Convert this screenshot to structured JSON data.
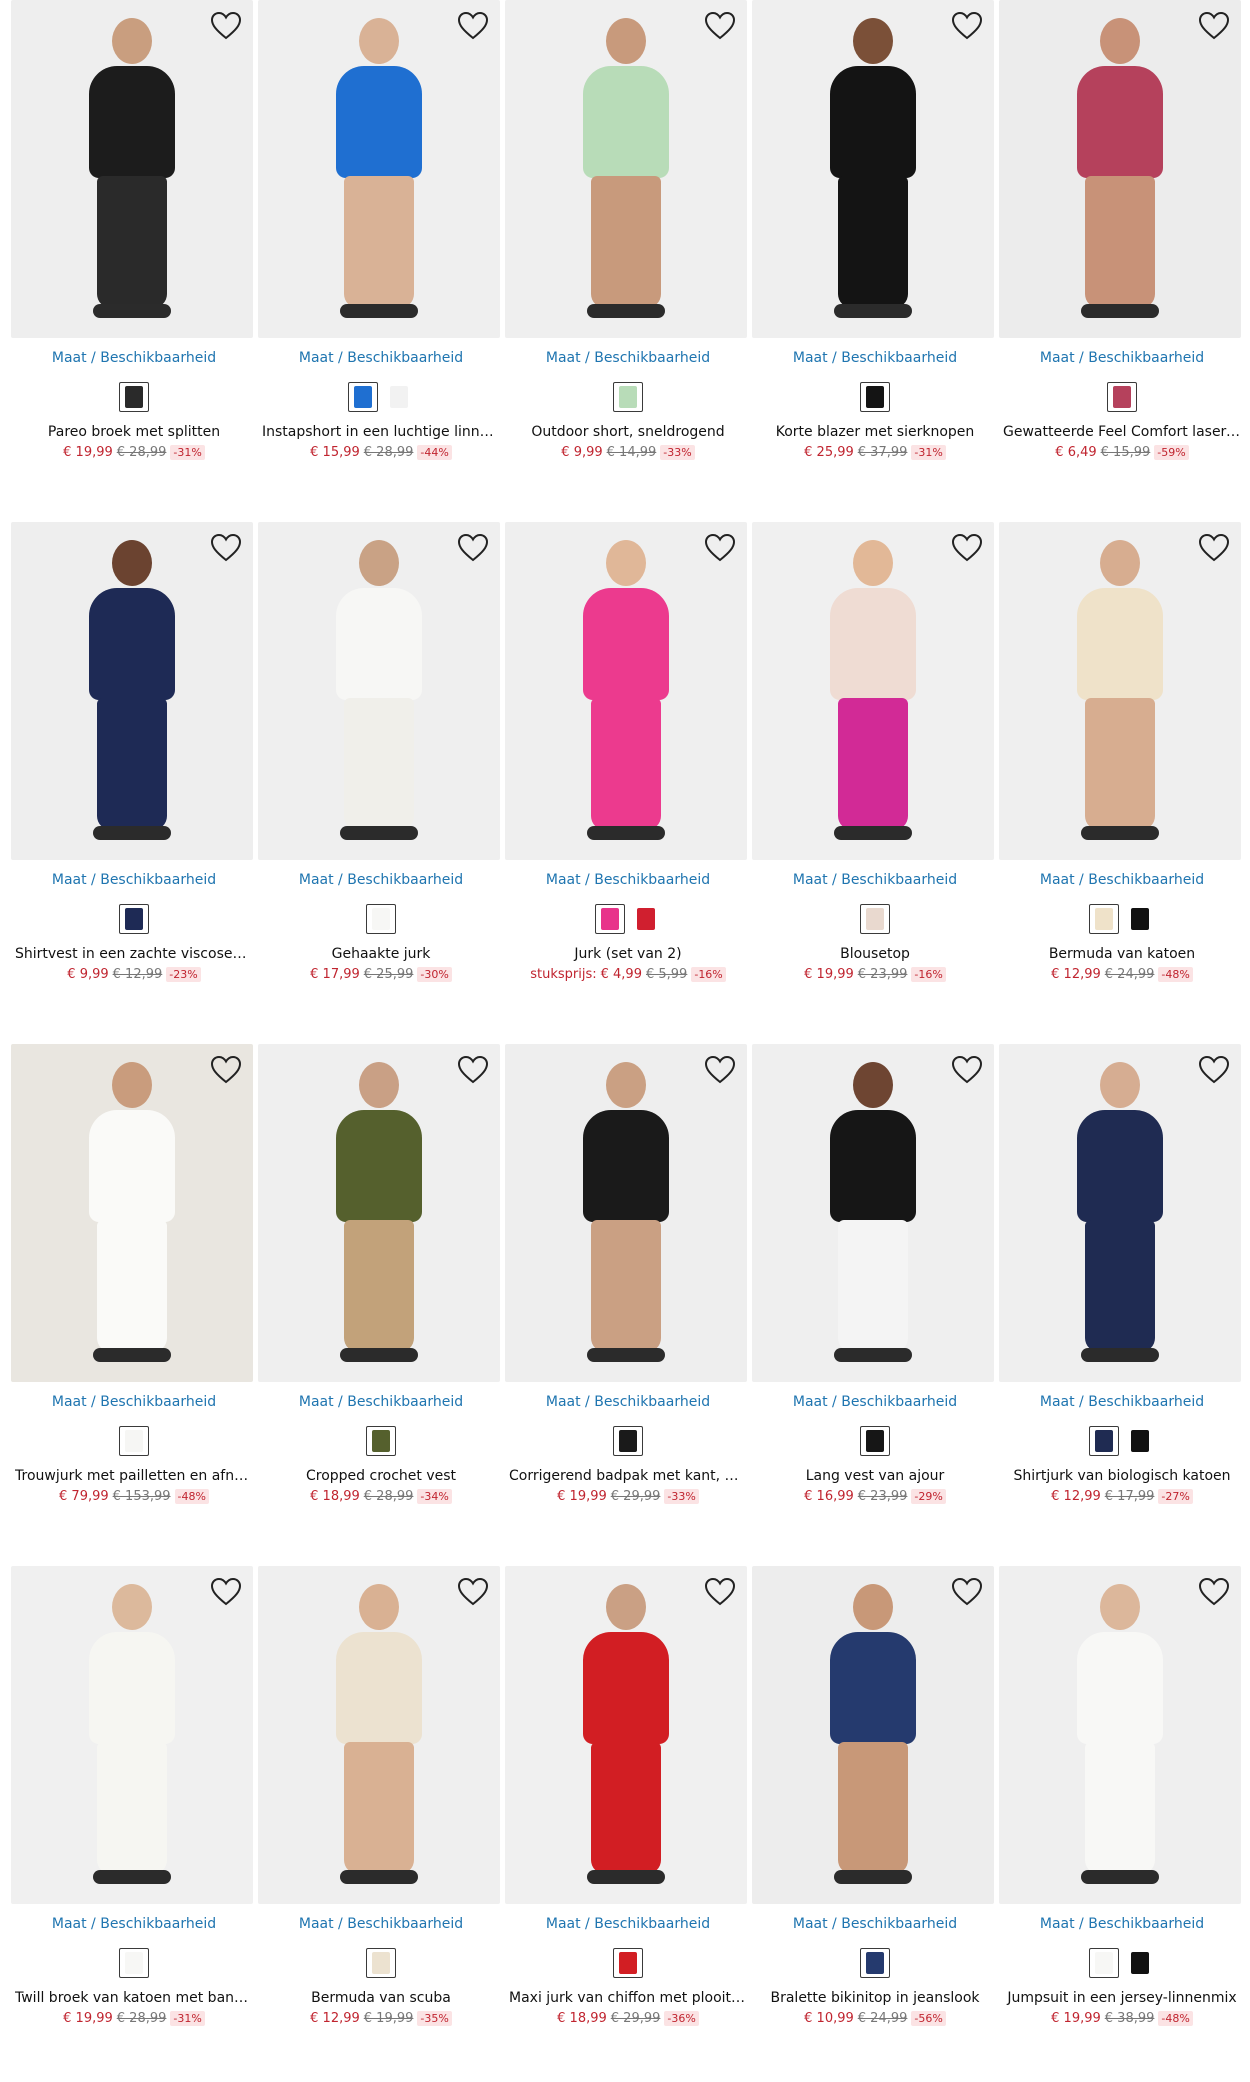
{
  "labels": {
    "size_availability": "Maat / Beschikbaarheid"
  },
  "colors": {
    "link": "#1f75b0",
    "price_now": "#c0242f",
    "price_old": "#777777",
    "discount_bg": "#fbe3e4"
  },
  "icons": {
    "wishlist": "heart-outline-icon"
  },
  "products": [
    [
      {
        "title": "Pareo broek met splitten",
        "price": "€ 19,99",
        "old_price": "€ 28,99",
        "discount": "-31%",
        "unit_label": "",
        "swatches": [
          "#2a2a2a"
        ],
        "bg": "#eeeeee",
        "body": "#1c1c1c",
        "legs": "#2a2a2a",
        "skin": "#c99e7f"
      },
      {
        "title": "Instapshort in een luchtige linnenmix",
        "price": "€ 15,99",
        "old_price": "€ 28,99",
        "discount": "-44%",
        "unit_label": "",
        "swatches": [
          "#1f6fd1",
          "#f2f2f2"
        ],
        "bg": "#efefef",
        "body": "#1f6fd1",
        "legs": "#d9b296",
        "skin": "#d9b296"
      },
      {
        "title": "Outdoor short, sneldrogend",
        "price": "€ 9,99",
        "old_price": "€ 14,99",
        "discount": "-33%",
        "unit_label": "",
        "swatches": [
          "#b8dcb8"
        ],
        "bg": "#efefef",
        "body": "#b8dcb8",
        "legs": "#c89a7c",
        "skin": "#c89a7c"
      },
      {
        "title": "Korte blazer met sierknopen",
        "price": "€ 25,99",
        "old_price": "€ 37,99",
        "discount": "-31%",
        "unit_label": "",
        "swatches": [
          "#141414"
        ],
        "bg": "#efefef",
        "body": "#141414",
        "legs": "#141414",
        "skin": "#7b5038"
      },
      {
        "title": "Gewatteerde Feel Comfort lasercut beha",
        "price": "€ 6,49",
        "old_price": "€ 15,99",
        "discount": "-59%",
        "unit_label": "",
        "swatches": [
          "#b5415c"
        ],
        "bg": "#ececec",
        "body": "#b5415c",
        "legs": "#c89278",
        "skin": "#c89278"
      }
    ],
    [
      {
        "title": "Shirtvest in een zachte viscosemix",
        "price": "€ 9,99",
        "old_price": "€ 12,99",
        "discount": "-23%",
        "unit_label": "",
        "swatches": [
          "#1e2a55"
        ],
        "bg": "#eeeeee",
        "body": "#1e2a55",
        "legs": "#1e2a55",
        "skin": "#6b4330"
      },
      {
        "title": "Gehaakte jurk",
        "price": "€ 17,99",
        "old_price": "€ 25,99",
        "discount": "-30%",
        "unit_label": "",
        "swatches": [
          "#f7f7f5"
        ],
        "bg": "#efefef",
        "body": "#f7f7f5",
        "legs": "#f0efea",
        "skin": "#c9a285"
      },
      {
        "title": "Jurk (set van 2)",
        "price": "€ 4,99",
        "old_price": "€ 5,99",
        "discount": "-16%",
        "unit_label": "stuksprijs:",
        "swatches": [
          "#e8338a",
          "#d01f2f"
        ],
        "bg": "#efefef",
        "body": "#ec3a8e",
        "legs": "#ec3a8e",
        "skin": "#e0b798"
      },
      {
        "title": "Blousetop",
        "price": "€ 19,99",
        "old_price": "€ 23,99",
        "discount": "-16%",
        "unit_label": "",
        "swatches": [
          "#e9d9cf"
        ],
        "bg": "#f0f0f0",
        "body": "#efdcd3",
        "legs": "#d22a96",
        "skin": "#e2b897"
      },
      {
        "title": "Bermuda van katoen",
        "price": "€ 12,99",
        "old_price": "€ 24,99",
        "discount": "-48%",
        "unit_label": "",
        "swatches": [
          "#efe2c9",
          "#111111"
        ],
        "bg": "#efefef",
        "body": "#efe2c9",
        "legs": "#d7ad90",
        "skin": "#d7ad90"
      }
    ],
    [
      {
        "title": "Trouwjurk met pailletten en afneembare rok",
        "price": "€ 79,99",
        "old_price": "€ 153,99",
        "discount": "-48%",
        "unit_label": "",
        "swatches": [
          "#f6f6f4"
        ],
        "bg": "#e9e6e0",
        "body": "#fafaf8",
        "legs": "#fafaf8",
        "skin": "#c99c7d"
      },
      {
        "title": "Cropped crochet vest",
        "price": "€ 18,99",
        "old_price": "€ 28,99",
        "discount": "-34%",
        "unit_label": "",
        "swatches": [
          "#55602d"
        ],
        "bg": "#efefef",
        "body": "#55602d",
        "legs": "#c2a27a",
        "skin": "#c9a085"
      },
      {
        "title": "Corrigerend badpak met kant, medium shaping",
        "price": "€ 19,99",
        "old_price": "€ 29,99",
        "discount": "-33%",
        "unit_label": "",
        "swatches": [
          "#1a1a1a"
        ],
        "bg": "#eeeeee",
        "body": "#1a1a1a",
        "legs": "#caa083",
        "skin": "#caa083"
      },
      {
        "title": "Lang vest van ajour",
        "price": "€ 16,99",
        "old_price": "€ 23,99",
        "discount": "-29%",
        "unit_label": "",
        "swatches": [
          "#161616"
        ],
        "bg": "#efefef",
        "body": "#161616",
        "legs": "#f4f4f4",
        "skin": "#6e4532"
      },
      {
        "title": "Shirtjurk van biologisch katoen",
        "price": "€ 12,99",
        "old_price": "€ 17,99",
        "discount": "-27%",
        "unit_label": "",
        "swatches": [
          "#1f2b52",
          "#111111"
        ],
        "bg": "#efefef",
        "body": "#1f2b52",
        "legs": "#1f2b52",
        "skin": "#d6ad92"
      }
    ],
    [
      {
        "title": "Twill broek van katoen met bandplooien",
        "price": "€ 19,99",
        "old_price": "€ 28,99",
        "discount": "-31%",
        "unit_label": "",
        "swatches": [
          "#f7f7f5"
        ],
        "bg": "#f0f0f0",
        "body": "#f6f6f2",
        "legs": "#f6f6f2",
        "skin": "#dcb99c"
      },
      {
        "title": "Bermuda van scuba",
        "price": "€ 12,99",
        "old_price": "€ 19,99",
        "discount": "-35%",
        "unit_label": "",
        "swatches": [
          "#ece2d0"
        ],
        "bg": "#efefef",
        "body": "#ece2d0",
        "legs": "#d9b193",
        "skin": "#d9b193"
      },
      {
        "title": "Maxi jurk van chiffon met plooitjes",
        "price": "€ 18,99",
        "old_price": "€ 29,99",
        "discount": "-36%",
        "unit_label": "",
        "swatches": [
          "#d21e23"
        ],
        "bg": "#f0f0f0",
        "body": "#d21e23",
        "legs": "#d21e23",
        "skin": "#caa084"
      },
      {
        "title": "Bralette bikinitop in jeanslook",
        "price": "€ 10,99",
        "old_price": "€ 24,99",
        "discount": "-56%",
        "unit_label": "",
        "swatches": [
          "#253a6e"
        ],
        "bg": "#ededed",
        "body": "#253a6e",
        "legs": "#c89878",
        "skin": "#c89878"
      },
      {
        "title": "Jumpsuit in een jersey-linnenmix",
        "price": "€ 19,99",
        "old_price": "€ 38,99",
        "discount": "-48%",
        "unit_label": "",
        "swatches": [
          "#f7f7f5",
          "#111111"
        ],
        "bg": "#efefef",
        "body": "#f8f8f6",
        "legs": "#f8f8f6",
        "skin": "#dcb79b"
      }
    ]
  ]
}
